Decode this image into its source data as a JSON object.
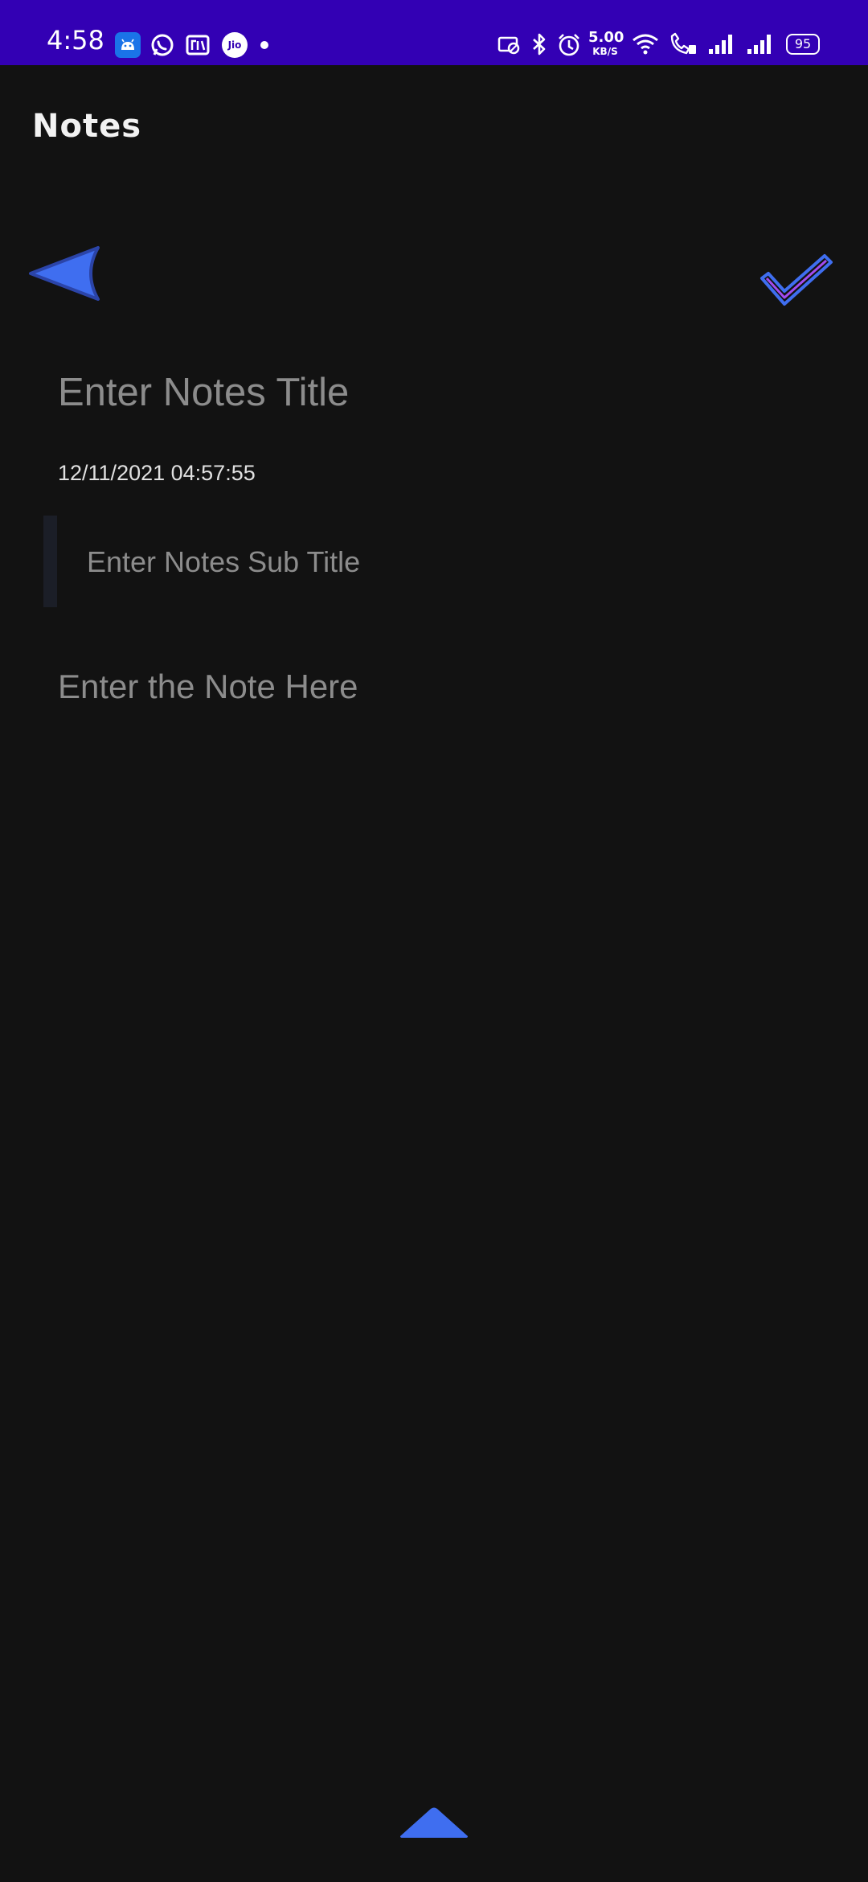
{
  "status_bar": {
    "time": "4:58",
    "notification_apps": [
      {
        "name": "android-icon",
        "label": ""
      },
      {
        "name": "whatsapp-icon",
        "label": ""
      },
      {
        "name": "paytm-icon",
        "label": ""
      },
      {
        "name": "jio-icon",
        "label": "Jio"
      }
    ],
    "net_speed_value": "5.00",
    "net_speed_unit": "KB/S",
    "battery": "95",
    "background_color": "#3300b4"
  },
  "app": {
    "title": "Notes"
  },
  "toolbar": {
    "back_icon": "back-arrow-icon",
    "save_icon": "checkmark-icon",
    "accent_color": "#3f6ef0",
    "check_color": "#a24bf0"
  },
  "form": {
    "title_placeholder": "Enter Notes Title",
    "title_value": "",
    "date_time": "12/11/2021 04:57:55",
    "subtitle_placeholder": "Enter Notes Sub Title",
    "subtitle_value": "",
    "note_placeholder": "Enter the Note Here",
    "note_value": ""
  },
  "bottom": {
    "toggle_icon": "chevron-up-icon"
  }
}
